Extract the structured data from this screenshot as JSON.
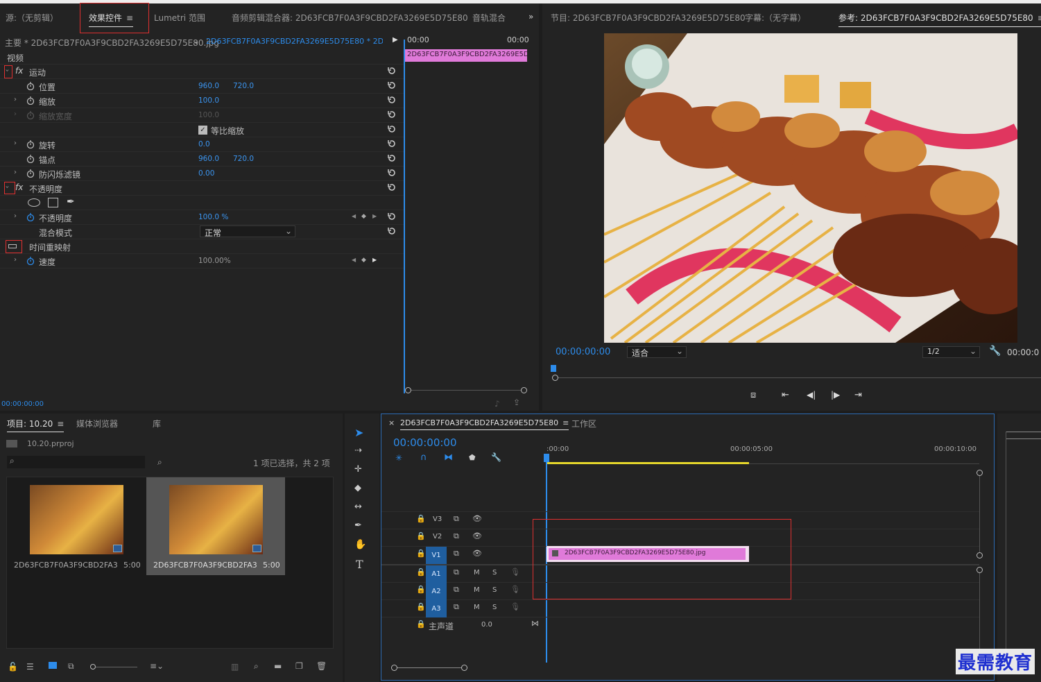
{
  "top_tabs_left": {
    "source": "源:（无剪辑）",
    "effect_controls": "效果控件",
    "lumetri": "Lumetri 范围",
    "audio_clip_mixer": "音频剪辑混合器: 2D63FCB7F0A3F9CBD2FA3269E5D75E80",
    "audio_track_mixer": "音轨混合"
  },
  "top_tabs_right": {
    "program": "节目: 2D63FCB7F0A3F9CBD2FA3269E5D75E80",
    "captions": "字幕:（无字幕）",
    "reference": "参考: 2D63FCB7F0A3F9CBD2FA3269E5D75E80"
  },
  "effect_controls": {
    "master_clip": "主要 * 2D63FCB7F0A3F9CBD2FA3269E5D75E80.jpg",
    "sequence_clip": "2D63FCB7F0A3F9CBD2FA3269E5D75E80 * 2D63...",
    "time_start": "00:00",
    "time_end": "00:00",
    "clip_bar_label": "2D63FCB7F0A3F9CBD2FA3269E5D",
    "section_video": "视频",
    "motion": "运动",
    "position": "位置",
    "position_x": "960.0",
    "position_y": "720.0",
    "scale": "缩放",
    "scale_val": "100.0",
    "scale_width": "缩放宽度",
    "scale_width_val": "100.0",
    "uniform_scale": "等比缩放",
    "rotation": "旋转",
    "rotation_val": "0.0",
    "anchor": "锚点",
    "anchor_x": "960.0",
    "anchor_y": "720.0",
    "anti_flicker": "防闪烁滤镜",
    "anti_flicker_val": "0.00",
    "opacity_group": "不透明度",
    "opacity": "不透明度",
    "opacity_val": "100.0 %",
    "blend_mode": "混合模式",
    "blend_mode_val": "正常",
    "time_remap": "时间重映射",
    "speed": "速度",
    "speed_val": "100.00%",
    "fx_label": "fx",
    "bottom_time": "00:00:00:00"
  },
  "program_monitor": {
    "timecode": "00:00:00:00",
    "fit": "适合",
    "resolution": "1/2",
    "timecode_right": "00:00:0"
  },
  "project_panel": {
    "tab_project": "项目: 10.20",
    "tab_media_browser": "媒体浏览器",
    "tab_library": "库",
    "project_file": "10.20.prproj",
    "selection_status": "1 项已选择，共 2 项",
    "items": [
      {
        "name": "2D63FCB7F0A3F9CBD2FA32...",
        "duration": "5:00"
      },
      {
        "name": "2D63FCB7F0A3F9CBD2FA32...",
        "duration": "5:00"
      }
    ]
  },
  "timeline": {
    "sequence_tab": "2D63FCB7F0A3F9CBD2FA3269E5D75E80",
    "work_area_tab": "工作区",
    "timecode": "00:00:00:00",
    "ruler": [
      ":00:00",
      "00:00:05:00",
      "00:00:10:00"
    ],
    "tracks_video": [
      "V3",
      "V2",
      "V1"
    ],
    "tracks_audio": [
      "A1",
      "A2",
      "A3"
    ],
    "mute": "M",
    "solo": "S",
    "master": "主声道",
    "master_val": "0.0",
    "clip_name": "2D63FCB7F0A3F9CBD2FA3269E5D75E80.jpg"
  },
  "watermark": "最需教育",
  "colors": {
    "accent_blue": "#2d8ceb",
    "clip_pink": "#e07ad9",
    "highlight_red": "#e03030",
    "work_area_yellow": "#e5d62b"
  }
}
